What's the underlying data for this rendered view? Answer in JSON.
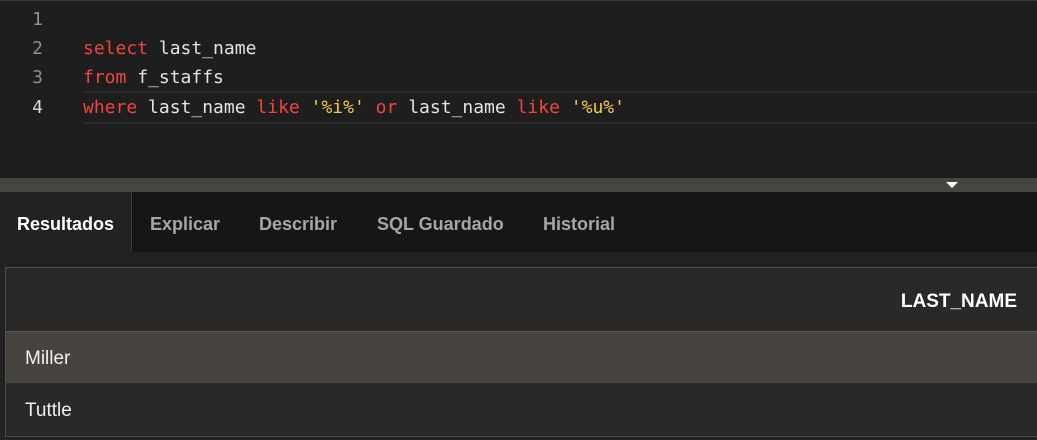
{
  "editor": {
    "lines": [
      {
        "num": "1"
      },
      {
        "num": "2",
        "tokens": [
          "select",
          "last_name"
        ]
      },
      {
        "num": "3",
        "tokens": [
          "from",
          "f_staffs"
        ]
      },
      {
        "num": "4",
        "tokens": [
          "where",
          "last_name",
          "like",
          "'%i%'",
          "or",
          "last_name",
          "like",
          "'%u%'"
        ]
      }
    ]
  },
  "tabs": [
    "Resultados",
    "Explicar",
    "Describir",
    "SQL Guardado",
    "Historial"
  ],
  "results": {
    "columns": [
      "LAST_NAME"
    ],
    "rows": [
      "Miller",
      "Tuttle"
    ]
  },
  "colors": {
    "keyword": "#f4443f",
    "string": "#f2c94c",
    "background": "#1e1e1e"
  },
  "icons": {
    "splitter": "chevron-down-icon"
  }
}
